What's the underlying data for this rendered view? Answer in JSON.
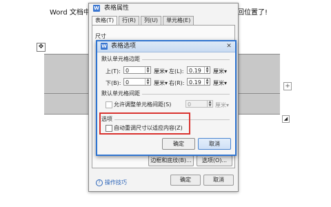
{
  "document": {
    "text_left": "Word 文档中",
    "text_right": "回位置了!",
    "move_handle": "✥",
    "add_column": "+",
    "resize_handle": "◢"
  },
  "outer_dialog": {
    "icon": "W",
    "title": "表格属性",
    "tabs": [
      "表格(T)",
      "行(R)",
      "列(U)",
      "单元格(E)"
    ],
    "size_label": "尺寸",
    "border_shading_button": "边框和底纹(B)...",
    "options_button": "选项(O)...",
    "tips_link": "操作技巧",
    "tips_icon": "?",
    "ok_button": "确定",
    "cancel_button": "取消"
  },
  "inner_dialog": {
    "icon": "W",
    "title": "表格选项",
    "close": "✕",
    "margins_group": "默认单元格边距",
    "top_label": "上(T):",
    "top_value": "0",
    "top_unit": "厘米▾",
    "left_label": "左(L):",
    "left_value": "0.19",
    "left_unit": "厘米▾",
    "bottom_label": "下(B):",
    "bottom_value": "0",
    "bottom_unit": "厘米▾",
    "right_label": "右(R):",
    "right_value": "0.19",
    "right_unit": "厘米▾",
    "spacing_group": "默认单元格间距",
    "allow_spacing_label": "允许调整单元格间距(S)",
    "spacing_value": "0",
    "spacing_unit": "厘米▾",
    "options_group": "选项",
    "autofit_label": "自动重调尺寸以适应内容(Z)",
    "ok_button": "确定",
    "cancel_button": "取消"
  }
}
